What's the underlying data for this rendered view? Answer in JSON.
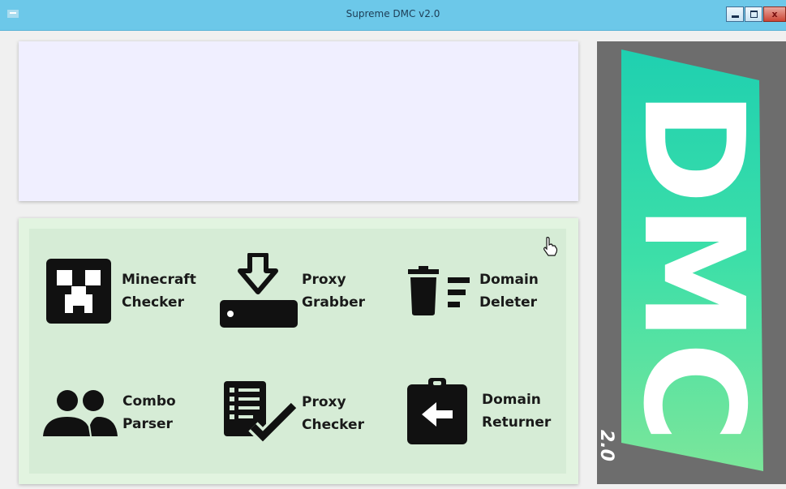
{
  "window": {
    "title": "Supreme DMC v2.0",
    "controls": {
      "minimize_icon": "minimize-icon",
      "maximize_icon": "maximize-icon",
      "close_label": "x"
    },
    "titlebar_color": "#6cc8e9"
  },
  "log_panel": {
    "background": "#f0efff"
  },
  "tools": [
    {
      "id": "minecraft-checker",
      "label": "Minecraft\nChecker",
      "icon": "creeper-icon"
    },
    {
      "id": "proxy-grabber",
      "label": "Proxy\nGrabber",
      "icon": "download-icon"
    },
    {
      "id": "domain-deleter",
      "label": "Domain\nDeleter",
      "icon": "trash-list-icon"
    },
    {
      "id": "combo-parser",
      "label": "Combo\nParser",
      "icon": "users-icon"
    },
    {
      "id": "proxy-checker",
      "label": "Proxy\nChecker",
      "icon": "checklist-icon"
    },
    {
      "id": "domain-returner",
      "label": "Domain\nReturner",
      "icon": "clipboard-arrow-icon"
    }
  ],
  "logo": {
    "text": "DMC",
    "version": "2.0",
    "gradient_colors": [
      "#2dd8a0",
      "#5ee39a"
    ],
    "background": "#6d6d6d"
  }
}
